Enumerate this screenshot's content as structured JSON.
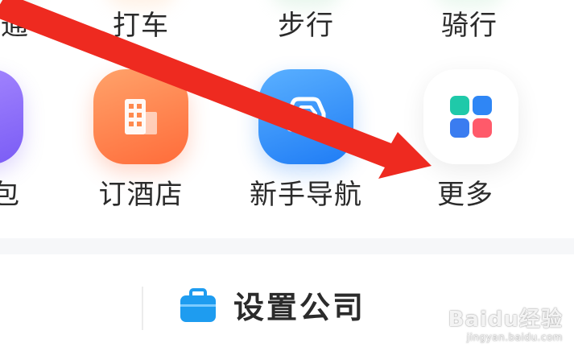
{
  "top_row": {
    "items": [
      {
        "label": "交通",
        "icon": "transit-icon",
        "color": "#e9f6ee"
      },
      {
        "label": "打车",
        "icon": "taxi-icon",
        "color": "#fff1e5"
      },
      {
        "label": "步行",
        "icon": "walk-icon",
        "color": "#e6f3ea"
      },
      {
        "label": "骑行",
        "icon": "bike-icon",
        "color": "#e8f6ed"
      }
    ]
  },
  "shortcut_row": {
    "items": [
      {
        "label": "钱包",
        "icon": "wallet-icon",
        "color": "#7a5cf5"
      },
      {
        "label": "订酒店",
        "icon": "hotel-icon",
        "color": "#ff6c3a"
      },
      {
        "label": "新手导航",
        "icon": "car-navigation-icon",
        "color": "#1f7cf5"
      },
      {
        "label": "更多",
        "icon": "grid-more-icon",
        "color": "#ffffff"
      }
    ]
  },
  "more_icon_colors": [
    "#1fc9a9",
    "#2f86f5",
    "#3a7cf0",
    "#ff5a6a"
  ],
  "bottom": {
    "company_label": "设置公司",
    "company_icon": "briefcase-icon",
    "company_icon_color": "#1e9cf0"
  },
  "annotation": {
    "type": "arrow",
    "color": "#ee2a20"
  },
  "watermark": {
    "brand": "Baidu经验",
    "url": "jingyan.baidu.com"
  }
}
